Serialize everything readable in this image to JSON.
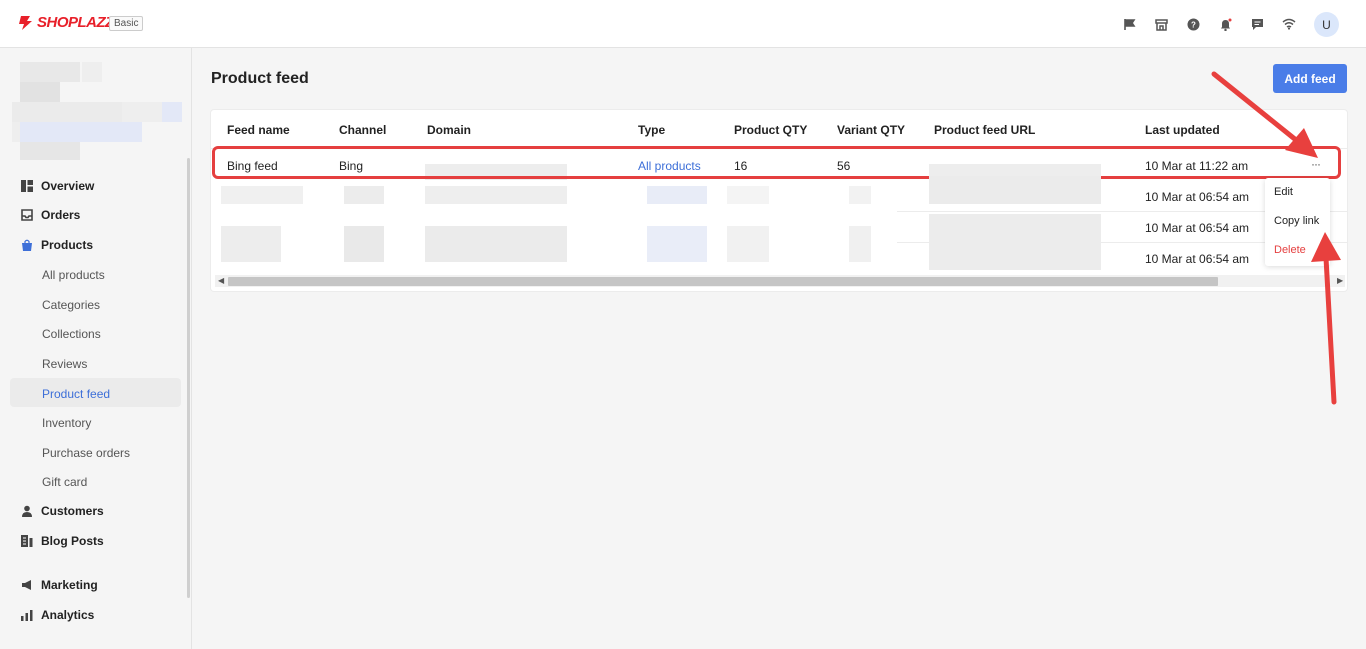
{
  "brand": {
    "name": "SHOPLAZZA",
    "plan": "Basic",
    "accent": "#e8202a"
  },
  "topbar": {
    "icons": [
      "flag-icon",
      "store-icon",
      "help-icon",
      "bell-icon",
      "message-icon",
      "wifi-icon"
    ],
    "avatar_letter": "U"
  },
  "sidebar": {
    "items": [
      {
        "label": "Overview",
        "icon": "overview-icon"
      },
      {
        "label": "Orders",
        "icon": "orders-icon"
      },
      {
        "label": "Products",
        "icon": "products-icon"
      },
      {
        "label": "Customers",
        "icon": "customers-icon"
      },
      {
        "label": "Blog Posts",
        "icon": "blog-icon"
      },
      {
        "label": "Marketing",
        "icon": "marketing-icon"
      },
      {
        "label": "Analytics",
        "icon": "analytics-icon"
      }
    ],
    "product_subitems": [
      "All products",
      "Categories",
      "Collections",
      "Reviews",
      "Product feed",
      "Inventory",
      "Purchase orders",
      "Gift card"
    ],
    "active_subitem": "Product feed"
  },
  "main": {
    "title": "Product feed",
    "add_button": "Add feed",
    "table": {
      "columns": [
        "Feed name",
        "Channel",
        "Domain",
        "Type",
        "Product QTY",
        "Variant QTY",
        "Product feed URL",
        "Last updated"
      ],
      "rows": [
        {
          "name": "Bing feed",
          "channel": "Bing",
          "domain": "",
          "type": "All products",
          "product_qty": "16",
          "variant_qty": "56",
          "url": "",
          "last_updated": "10 Mar at 11:22 am"
        },
        {
          "name": "",
          "channel": "",
          "domain": "",
          "type": "",
          "product_qty": "",
          "variant_qty": "",
          "url": "",
          "last_updated": "10 Mar at 06:54 am"
        },
        {
          "name": "",
          "channel": "",
          "domain": "",
          "type": "",
          "product_qty": "",
          "variant_qty": "",
          "url": "",
          "last_updated": "10 Mar at 06:54 am"
        },
        {
          "name": "",
          "channel": "",
          "domain": "",
          "type": "",
          "product_qty": "",
          "variant_qty": "",
          "url": "",
          "last_updated": "10 Mar at 06:54 am"
        }
      ],
      "more_label": "···"
    },
    "row_menu": {
      "items": [
        "Edit",
        "Copy link",
        "Delete"
      ]
    }
  },
  "colors": {
    "primary": "#4a7de8",
    "link": "#3d6fd8",
    "highlight": "#e53f3f"
  }
}
